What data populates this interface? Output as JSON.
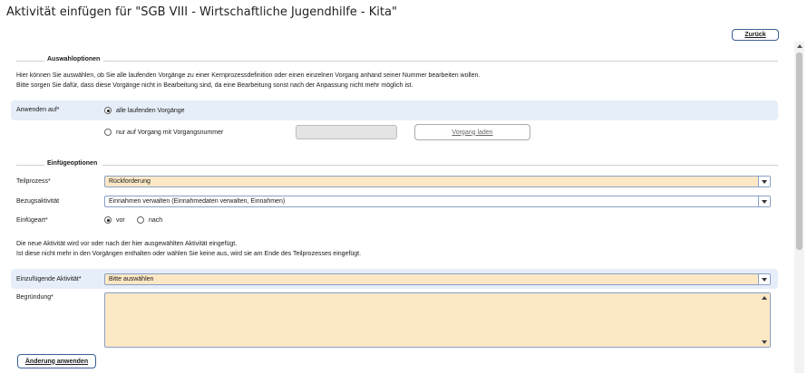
{
  "page": {
    "title": "Aktivität einfügen für \"SGB VIII - Wirtschaftliche Jugendhilfe - Kita\"",
    "back_label": "Zurück",
    "apply_label": "Änderung anwenden"
  },
  "auswahl": {
    "heading": "Auswahloptionen",
    "info_line1": "Hier können Sie auswählen, ob Sie alle laufenden Vorgänge zu einer Kernprozessdefinition oder einen einzelnen Vorgang anhand seiner Nummer bearbeiten wollen.",
    "info_line2": "Bitte sorgen Sie dafür, dass diese Vorgänge nicht in Bearbeitung sind, da eine Bearbeitung sonst nach der Anpassung nicht mehr möglich ist.",
    "anwenden_label": "Anwenden auf*",
    "option_all": "alle laufenden Vorgänge",
    "option_single": "nur auf Vorgang mit Vorgangsnummer",
    "selected": "alle laufenden Vorgänge",
    "vorgang_nummer": "",
    "load_label": "Vorgang laden"
  },
  "einfuege": {
    "heading": "Einfügeoptionen",
    "teilprozess_label": "Teilprozess*",
    "teilprozess_value": "Rückforderung",
    "bezug_label": "Bezugsaktivität",
    "bezug_value": "Einnahmen verwalten (Einnahmedaten verwalten, Einnahmen)",
    "einfuegeart_label": "Einfügeart*",
    "option_vor": "vor",
    "option_nach": "nach",
    "einfuegeart_selected": "vor",
    "info_line1": "Die neue Aktivität wird vor oder nach der hier ausgewählten Aktivität eingefügt.",
    "info_line2": "Ist diese nicht mehr in den Vorgängen enthalten oder wählen Sie keine aus, wird sie am Ende des Teilprozesses eingefügt.",
    "aktivitaet_label": "Einzufügende Aktivität*",
    "aktivitaet_value": "Bitte auswählen",
    "begruendung_label": "Begründung*",
    "begruendung_value": ""
  },
  "colors": {
    "required_field": "#fde8c6",
    "highlight_row": "#e6eef9",
    "border_accent": "#8aa0c6"
  }
}
